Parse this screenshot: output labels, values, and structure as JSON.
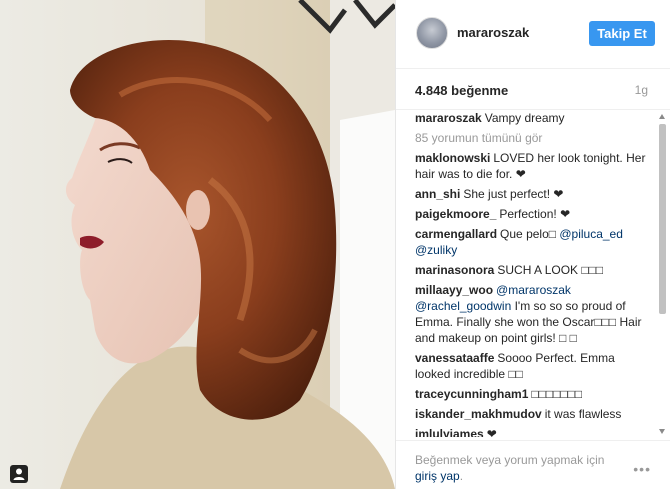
{
  "post": {
    "username": "mararoszak",
    "follow_label": "Takip Et",
    "likes": "4.848 beğenme",
    "time": "1g"
  },
  "caption": {
    "user": "mararoszak",
    "text": "Vampy dreamy"
  },
  "more_comments": "85 yorumun tümünü gör",
  "comments": [
    {
      "user": "maklonowski",
      "segments": [
        {
          "t": "LOVED her look tonight. Her hair was to die for. ❤"
        }
      ]
    },
    {
      "user": "ann_shi",
      "segments": [
        {
          "t": "She just perfect! ❤"
        }
      ]
    },
    {
      "user": "paigekmoore_",
      "segments": [
        {
          "t": "Perfection! ❤"
        }
      ]
    },
    {
      "user": "carmengallard",
      "segments": [
        {
          "t": "Que pelo□ "
        },
        {
          "m": "@piluca_ed"
        },
        {
          "t": " "
        },
        {
          "m": "@zuliky"
        }
      ]
    },
    {
      "user": "marinasonora",
      "segments": [
        {
          "t": "SUCH A LOOK □□□"
        }
      ]
    },
    {
      "user": "millaayy_woo",
      "segments": [
        {
          "m": "@mararoszak"
        },
        {
          "t": " "
        },
        {
          "m": "@rachel_goodwin"
        },
        {
          "t": " I'm so so so proud of Emma. Finally she won the Oscar□□□ Hair and makeup on point girls! □ □"
        }
      ]
    },
    {
      "user": "vanessataaffe",
      "segments": [
        {
          "t": "Soooo Perfect. Emma looked incredible □□"
        }
      ]
    },
    {
      "user": "traceycunningham1",
      "segments": [
        {
          "t": "□□□□□□□"
        }
      ]
    },
    {
      "user": "iskander_makhmudov",
      "segments": [
        {
          "t": "it was flawless"
        }
      ]
    },
    {
      "user": "imlulyjames",
      "segments": [
        {
          "t": "❤"
        }
      ]
    }
  ],
  "footer": {
    "cta_prefix": "Beğenmek veya yorum yapmak için ",
    "login_label": "giriş yap",
    "cta_suffix": ".",
    "more_icon": "ellipsis-icon"
  },
  "colors": {
    "accent": "#3897f0",
    "link": "#003569",
    "muted": "#999999"
  }
}
